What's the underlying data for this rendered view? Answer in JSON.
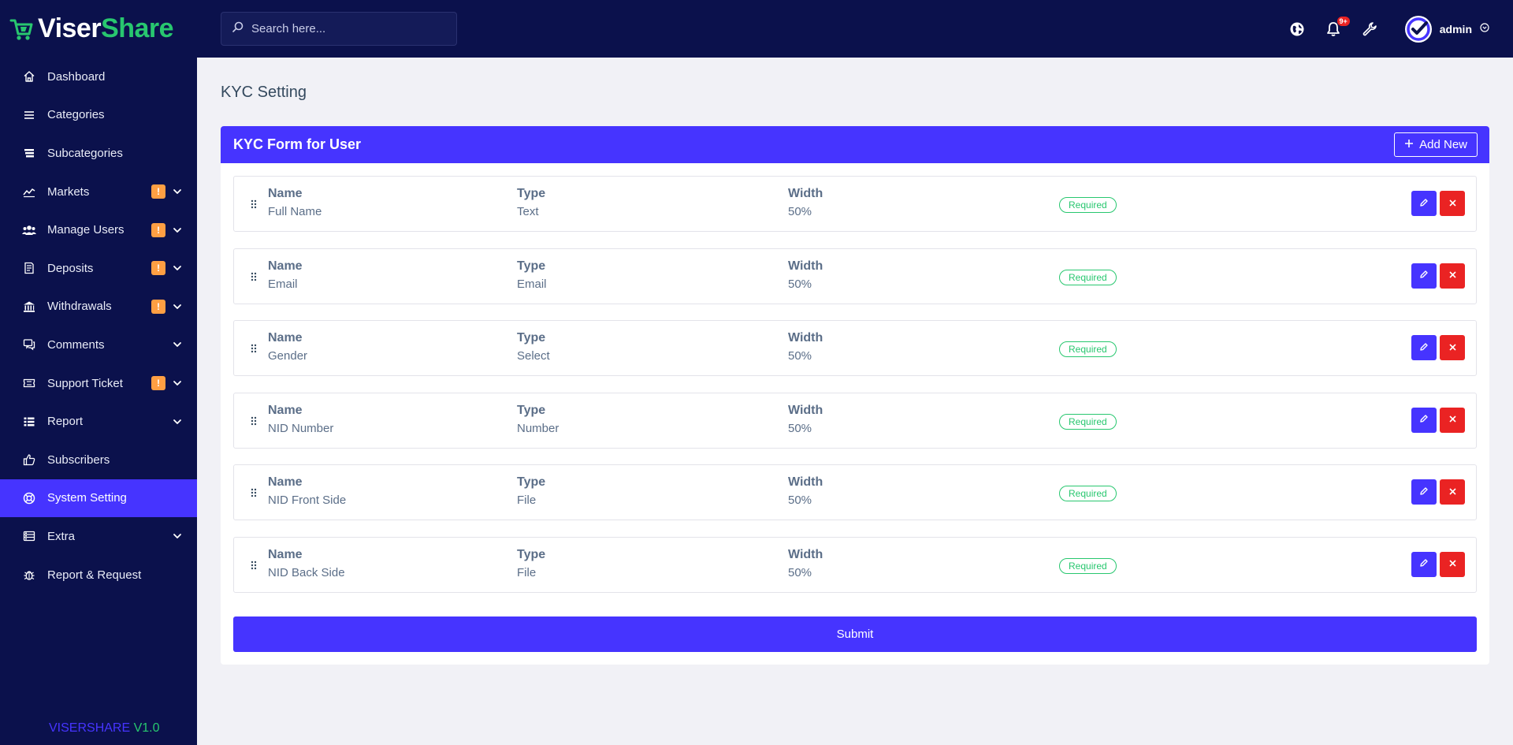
{
  "brand": {
    "part1": "Viser",
    "part2": "Share"
  },
  "sidebar": {
    "items": [
      {
        "label": "Dashboard",
        "icon": "home-icon",
        "badge": "",
        "chevron": false
      },
      {
        "label": "Categories",
        "icon": "menu-icon",
        "badge": "",
        "chevron": false
      },
      {
        "label": "Subcategories",
        "icon": "layers-icon",
        "badge": "",
        "chevron": false
      },
      {
        "label": "Markets",
        "icon": "chart-icon",
        "badge": "!",
        "chevron": true
      },
      {
        "label": "Manage Users",
        "icon": "users-icon",
        "badge": "!",
        "chevron": true
      },
      {
        "label": "Deposits",
        "icon": "invoice-icon",
        "badge": "!",
        "chevron": true
      },
      {
        "label": "Withdrawals",
        "icon": "bank-icon",
        "badge": "!",
        "chevron": true
      },
      {
        "label": "Comments",
        "icon": "comments-icon",
        "badge": "",
        "chevron": true
      },
      {
        "label": "Support Ticket",
        "icon": "ticket-icon",
        "badge": "!",
        "chevron": true
      },
      {
        "label": "Report",
        "icon": "list-icon",
        "badge": "",
        "chevron": true
      },
      {
        "label": "Subscribers",
        "icon": "thumbs-up-icon",
        "badge": "",
        "chevron": false
      },
      {
        "label": "System Setting",
        "icon": "life-ring-icon",
        "badge": "",
        "chevron": false,
        "active": true
      },
      {
        "label": "Extra",
        "icon": "server-icon",
        "badge": "",
        "chevron": true
      },
      {
        "label": "Report & Request",
        "icon": "bug-icon",
        "badge": "",
        "chevron": false
      }
    ],
    "version_name": "VISERSHARE",
    "version_num": "V1.0"
  },
  "topbar": {
    "search_placeholder": "Search here...",
    "notification_count": "9+",
    "user_name": "admin"
  },
  "page": {
    "title": "KYC Setting"
  },
  "card": {
    "title": "KYC Form for User",
    "add_label": "Add New",
    "col_name": "Name",
    "col_type": "Type",
    "col_width": "Width",
    "required_label": "Required",
    "fields": [
      {
        "name": "Full Name",
        "type": "Text",
        "width": "50%"
      },
      {
        "name": "Email",
        "type": "Email",
        "width": "50%"
      },
      {
        "name": "Gender",
        "type": "Select",
        "width": "50%"
      },
      {
        "name": "NID Number",
        "type": "Number",
        "width": "50%"
      },
      {
        "name": "NID Front Side",
        "type": "File",
        "width": "50%"
      },
      {
        "name": "NID Back Side",
        "type": "File",
        "width": "50%"
      }
    ],
    "submit_label": "Submit"
  },
  "colors": {
    "sidebar_bg": "#0b114c",
    "primary": "#4634ff",
    "success": "#28c76f",
    "danger": "#ea2323",
    "warning": "#ff9f43"
  }
}
